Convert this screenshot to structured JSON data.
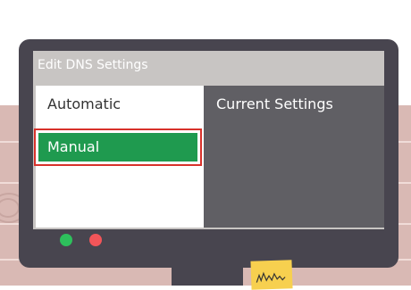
{
  "colors": {
    "background_top": "#ffffff",
    "wood": "#d9b9b4",
    "wood_line": "#f0dcd8",
    "wood_ring": "#c8a6a1",
    "monitor_frame": "#48454f",
    "screen_bezel": "#c8c5c3",
    "title_text": "#ffffff",
    "left_panel": "#ffffff",
    "right_panel": "#605f64",
    "option_text": "#333333",
    "selected_fill": "#1f9a4f",
    "selected_border": "#d8322b",
    "selected_text": "#ffffff",
    "current_settings_text": "#ffffff",
    "green_dot": "#2ec05c",
    "red_dot": "#f25559",
    "stand": "#48454f",
    "sticky_note": "#f7d04f",
    "scribble": "#333333"
  },
  "window": {
    "title": "Edit DNS Settings"
  },
  "dns_options": {
    "automatic_label": "Automatic",
    "manual_label": "Manual",
    "selected": "Manual"
  },
  "current_settings": {
    "heading": "Current Settings"
  },
  "monitor_buttons": [
    {
      "icon": "green-dot-icon",
      "color": "#2ec05c"
    },
    {
      "icon": "red-dot-icon",
      "color": "#f25559"
    }
  ]
}
